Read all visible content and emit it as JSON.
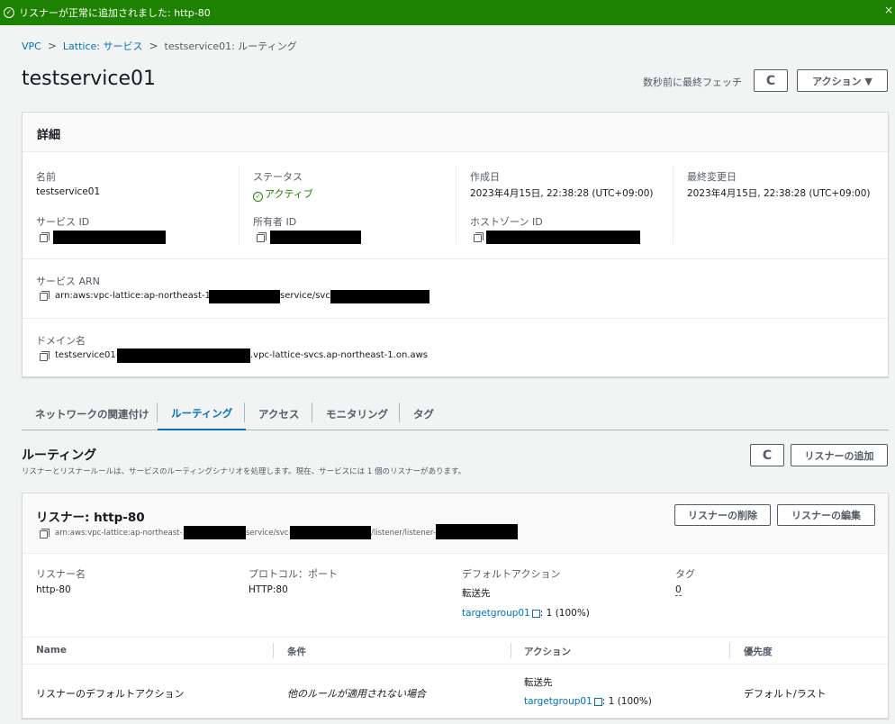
{
  "banner": {
    "message": "リスナーが正常に追加されました: http-80",
    "close": "×"
  },
  "breadcrumb": {
    "vpc": "VPC",
    "lattice": "Lattice: サービス",
    "current": "testservice01: ルーティング",
    "sep": ">"
  },
  "header": {
    "title": "testservice01",
    "fetched": "数秒前に最終フェッチ",
    "refresh": "C",
    "actions": "アクション ▼"
  },
  "details": {
    "heading": "詳細",
    "name_label": "名前",
    "name_value": "testservice01",
    "status_label": "ステータス",
    "status_value": "アクティブ",
    "created_label": "作成日",
    "created_value": "2023年4月15日, 22:38:28 (UTC+09:00)",
    "modified_label": "最終変更日",
    "modified_value": "2023年4月15日, 22:38:28 (UTC+09:00)",
    "service_id_label": "サービス ID",
    "owner_id_label": "所有者 ID",
    "hosted_zone_label": "ホストゾーン ID",
    "arn_label": "サービス ARN",
    "arn_prefix": "arn:aws:vpc-lattice:ap-northeast-1:",
    "arn_mid": "service/svc-",
    "domain_label": "ドメイン名",
    "domain_prefix": "testservice01-",
    "domain_suffix": ".vpc-lattice-svcs.ap-northeast-1.on.aws"
  },
  "tabs": [
    "ネットワークの関連付け",
    "ルーティング",
    "アクセス",
    "モニタリング",
    "タグ"
  ],
  "routing": {
    "title": "ルーティング",
    "description": "リスナーとリスナールールは、サービスのルーティングシナリオを処理します。現在、サービスには 1 個のリスナーがあります。",
    "refresh": "C",
    "add_listener": "リスナーの追加"
  },
  "listener": {
    "title": "リスナー: http-80",
    "arn_prefix": "arn:aws:vpc-lattice:ap-northeast-1",
    "arn_service": "service/svc-",
    "arn_listener": "/listener/listener-",
    "delete": "リスナーの削除",
    "edit": "リスナーの編集",
    "name_label": "リスナー名",
    "name_value": "http-80",
    "protocol_label": "プロトコル：ポート",
    "protocol_value": "HTTP:80",
    "default_action_label": "デフォルトアクション",
    "forward_to": "転送先",
    "target_group": "targetgroup01",
    "target_weight": ": 1 (100%)",
    "tags_label": "タグ",
    "tags_value": "0"
  },
  "rules_table": {
    "headers": [
      "Name",
      "条件",
      "アクション",
      "優先度"
    ],
    "row": {
      "name": "リスナーのデフォルトアクション",
      "condition": "他のルールが適用されない場合",
      "action_forward": "転送先",
      "target_group": "targetgroup01",
      "target_weight": ": 1 (100%)",
      "priority": "デフォルト/ラスト"
    }
  }
}
